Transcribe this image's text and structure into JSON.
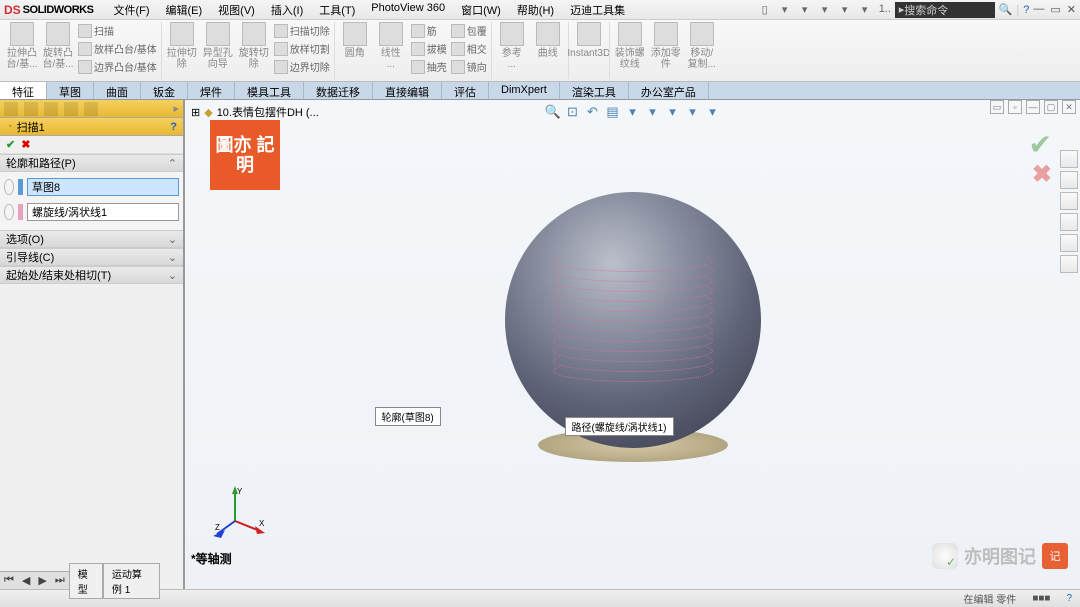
{
  "title": {
    "brand_prefix": "DS",
    "brand": "SOLIDWORKS"
  },
  "menu": [
    "文件(F)",
    "编辑(E)",
    "视图(V)",
    "插入(I)",
    "工具(T)",
    "PhotoView 360",
    "窗口(W)",
    "帮助(H)",
    "迈迪工具集"
  ],
  "title_right": {
    "history": "1..",
    "search_placeholder": "搜索命令"
  },
  "ribbon": {
    "big": [
      "拉伸凸\n台/基...",
      "旋转凸\n台/基...",
      "扫描",
      "放样凸台/基体",
      "边界凸台/基体",
      "拉伸切\n除",
      "异型孔\n向导",
      "旋转切\n除",
      "扫描切除",
      "放样切割",
      "边界切除",
      "圆角",
      "线性\n...",
      "筋",
      "拔模",
      "抽壳",
      "包覆",
      "相交",
      "镜向",
      "参考\n...",
      "曲线",
      "Instant3D",
      "装饰螺\n纹线",
      "添加零\n件",
      "移动/\n复制..."
    ]
  },
  "cmd_tabs": [
    "特征",
    "草图",
    "曲面",
    "钣金",
    "焊件",
    "模具工具",
    "数据迁移",
    "直接编辑",
    "评估",
    "DimXpert",
    "渲染工具",
    "办公室产品"
  ],
  "feature": {
    "name": "扫描1",
    "groups": {
      "profile_path": {
        "title": "轮廓和路径(P)",
        "profile_value": "草图8",
        "path_value": "螺旋线/涡状线1"
      },
      "options": {
        "title": "选项(O)"
      },
      "guides": {
        "title": "引导线(C)"
      },
      "tangent": {
        "title": "起始处/结束处相切(T)"
      }
    }
  },
  "doc": {
    "title": "10.表情包摆件DH  (..."
  },
  "stamp_text": "圖亦\n記明",
  "callouts": {
    "profile": "轮廓(草图8)",
    "path": "路径(螺旋线/涡状线1)"
  },
  "triad_labels": {
    "x": "X",
    "y": "Y",
    "z": "Z"
  },
  "view_name": "*等轴测",
  "bottom_tabs": [
    "模型",
    "运动算例 1"
  ],
  "status": {
    "mode": "在编辑 零件",
    "extra": "■■■"
  },
  "watermark": {
    "text": "亦明图记",
    "stamp": "记"
  }
}
